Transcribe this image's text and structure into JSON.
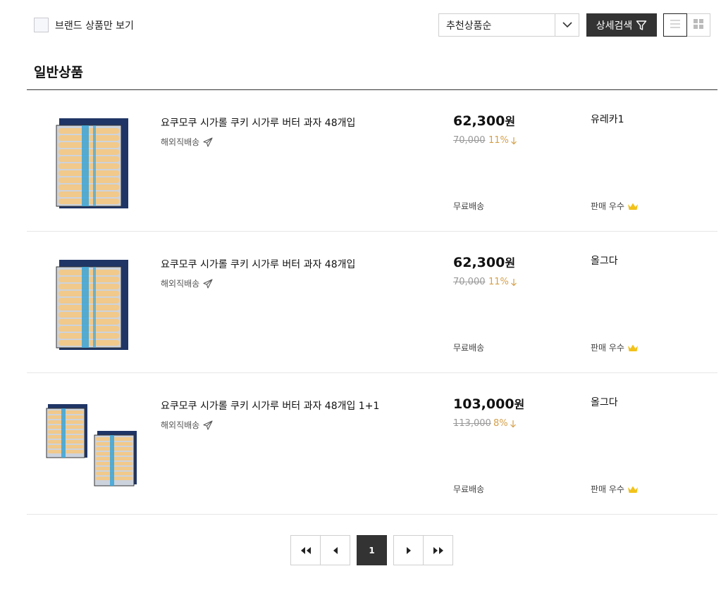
{
  "filters": {
    "brand_only_label": "브랜드 상품만 보기",
    "sort_selected": "추천상품순",
    "detail_search_label": "상세검색"
  },
  "section_title": "일반상품",
  "products": [
    {
      "name": "요쿠모쿠 시가롤 쿠키 시가루 버터 과자 48개입",
      "shipping_tag": "해외직배송",
      "price": "62,300",
      "price_unit": "원",
      "original_price": "70,000",
      "discount": "11%",
      "delivery": "무료배송",
      "seller": "유레카1",
      "seller_badge": "판매 우수"
    },
    {
      "name": "요쿠모쿠 시가롤 쿠키 시가루 버터 과자 48개입",
      "shipping_tag": "해외직배송",
      "price": "62,300",
      "price_unit": "원",
      "original_price": "70,000",
      "discount": "11%",
      "delivery": "무료배송",
      "seller": "올그다",
      "seller_badge": "판매 우수"
    },
    {
      "name": "요쿠모쿠 시가롤 쿠키 시가루 버터 과자 48개입 1+1",
      "shipping_tag": "해외직배송",
      "price": "103,000",
      "price_unit": "원",
      "original_price": "113,000",
      "discount": "8%",
      "delivery": "무료배송",
      "seller": "올그다",
      "seller_badge": "판매 우수"
    }
  ],
  "pagination": {
    "current_page": "1"
  },
  "colors": {
    "discount": "#d4a04a",
    "dark_button": "#333333",
    "crown": "#f2c21b",
    "package_navy": "#1f3566",
    "cookie": "#f1c98b",
    "ribbon": "#3aa5d8"
  }
}
